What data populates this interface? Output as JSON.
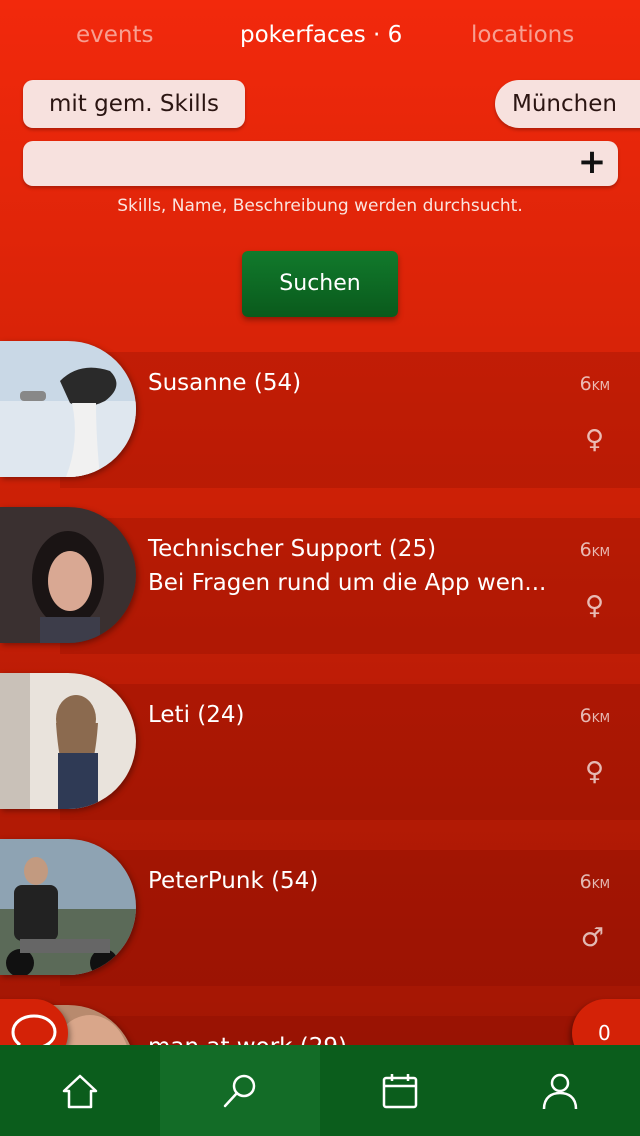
{
  "tabs": {
    "events": "events",
    "pokerfaces": "pokerfaces · 6",
    "locations": "locations"
  },
  "filters": {
    "skills_label": "mit gem. Skills",
    "city_label": "München"
  },
  "search": {
    "value": "",
    "placeholder": "",
    "hint": "Skills, Name, Beschreibung werden durchsucht.",
    "button_label": "Suchen"
  },
  "results": [
    {
      "name": "Susanne (54)",
      "description": "",
      "distance": "6",
      "unit": "KM",
      "gender": "♀"
    },
    {
      "name": "Technischer Support (25)",
      "description": "Bei Fragen rund um die App wen...",
      "distance": "6",
      "unit": "KM",
      "gender": "♀"
    },
    {
      "name": "Leti (24)",
      "description": "",
      "distance": "6",
      "unit": "KM",
      "gender": "♀"
    },
    {
      "name": "PeterPunk (54)",
      "description": "",
      "distance": "6",
      "unit": "KM",
      "gender": "♂"
    },
    {
      "name": "man at work (29)",
      "description": "",
      "distance": "",
      "unit": "",
      "gender": ""
    }
  ],
  "chat_count": "0",
  "nav": {
    "items": [
      "home-icon",
      "search-icon",
      "calendar-icon",
      "profile-icon"
    ],
    "active": "search-icon"
  },
  "colors": {
    "background_top": "#f2290c",
    "background_bottom": "#9c1504",
    "accent_green": "#0b5d1c",
    "chip": "#f7e1de"
  }
}
